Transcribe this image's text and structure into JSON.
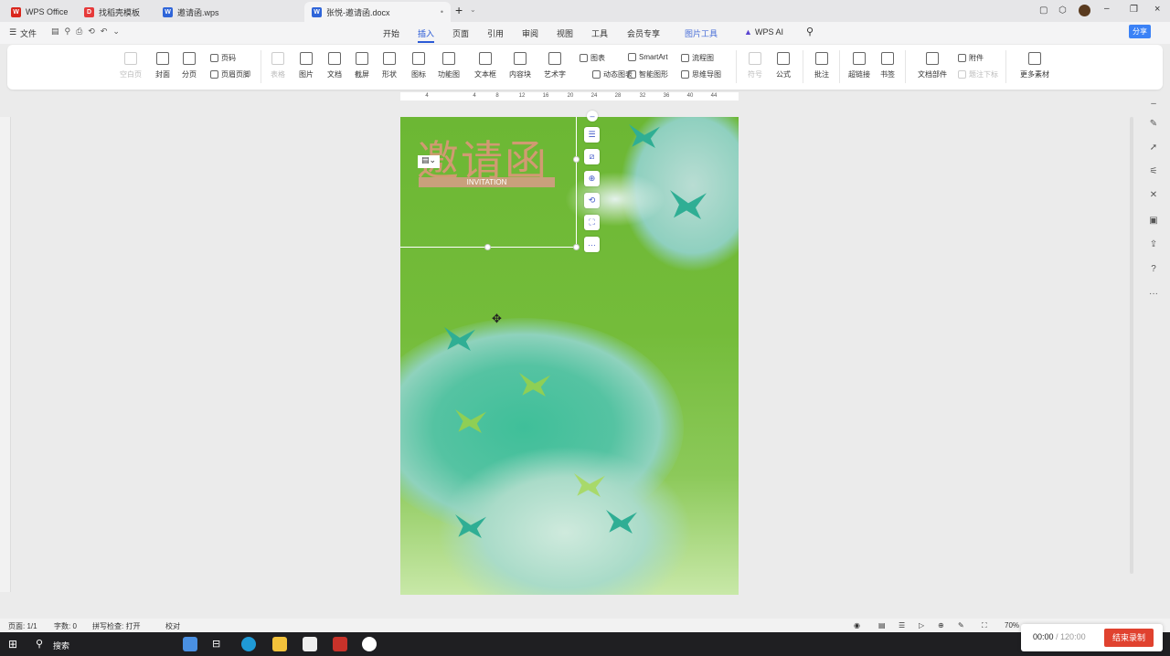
{
  "tabs": [
    {
      "label": "WPS Office",
      "icon": "wps-logo-icon",
      "color": "#d9261c"
    },
    {
      "label": "找稻壳模板",
      "icon": "docer-icon",
      "color": "#e63a3a"
    },
    {
      "label": "邀请函.wps",
      "icon": "word-doc-icon",
      "color": "#2f65d9"
    },
    {
      "label": "张悦-邀请函.docx",
      "icon": "word-doc-icon",
      "color": "#2f65d9"
    }
  ],
  "menu": {
    "file": "文件",
    "tabs": [
      "开始",
      "插入",
      "页面",
      "引用",
      "审阅",
      "视图",
      "工具",
      "会员专享",
      "图片工具",
      "WPS AI"
    ],
    "active": "插入",
    "share": "分享"
  },
  "ribbon": {
    "items": [
      "空白页",
      "封面",
      "分页",
      "页码",
      "页眉页脚",
      "表格",
      "图片",
      "文档",
      "截屏",
      "形状",
      "图标",
      "功能图",
      "文本框",
      "内容块",
      "艺术字",
      "图表",
      "动态图表",
      "SmartArt",
      "智能图形",
      "流程图",
      "思维导图",
      "符号",
      "公式",
      "批注",
      "超链接",
      "书签",
      "文档部件",
      "附件",
      "题注下标",
      "更多素材"
    ]
  },
  "ruler": [
    "4",
    "4",
    "8",
    "12",
    "16",
    "20",
    "24",
    "28",
    "32",
    "36",
    "40",
    "44"
  ],
  "document": {
    "title": "邀请函",
    "subtitle": "INVITATION",
    "colors": {
      "green": "#6cb734",
      "teal": "#2fae94",
      "tan": "#c9a07c"
    }
  },
  "status": {
    "page": "页面: 1/1",
    "words": "字数: 0",
    "spell": "拼写检查: 打开",
    "proof": "校对",
    "zoom": "70%"
  },
  "taskbar": {
    "search": "搜索"
  },
  "recording": {
    "elapsed": "00:00",
    "total": "/ 120:00",
    "stop": "结束录制"
  }
}
